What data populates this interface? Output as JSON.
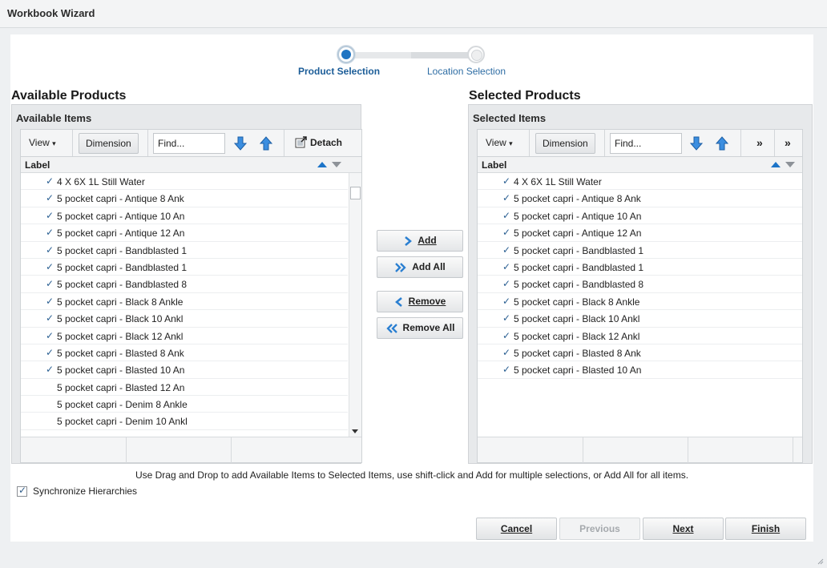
{
  "window": {
    "title": "Workbook Wizard"
  },
  "train": {
    "steps": [
      {
        "label": "Product Selection",
        "state": "active"
      },
      {
        "label": "Location Selection",
        "state": "inactive"
      }
    ]
  },
  "available": {
    "section_title": "Available Products",
    "panel_title": "Available Items",
    "toolbar": {
      "view": "View",
      "dimension": "Dimension",
      "find_placeholder": "Find...",
      "detach": "Detach"
    },
    "column_label": "Label",
    "rows": [
      {
        "checked": true,
        "text": "4 X 6X 1L Still Water"
      },
      {
        "checked": true,
        "text": "5 pocket capri - Antique 8 Ank"
      },
      {
        "checked": true,
        "text": "5 pocket capri - Antique 10 An"
      },
      {
        "checked": true,
        "text": "5 pocket capri - Antique 12 An"
      },
      {
        "checked": true,
        "text": "5 pocket capri - Bandblasted 1"
      },
      {
        "checked": true,
        "text": "5 pocket capri - Bandblasted 1"
      },
      {
        "checked": true,
        "text": "5 pocket capri - Bandblasted 8"
      },
      {
        "checked": true,
        "text": "5 pocket capri - Black 8 Ankle"
      },
      {
        "checked": true,
        "text": "5 pocket capri - Black 10 Ankl"
      },
      {
        "checked": true,
        "text": "5 pocket capri - Black 12 Ankl"
      },
      {
        "checked": true,
        "text": "5 pocket capri - Blasted 8 Ank"
      },
      {
        "checked": true,
        "text": "5 pocket capri - Blasted 10 An"
      },
      {
        "checked": false,
        "text": "5 pocket capri - Blasted 12 An"
      },
      {
        "checked": false,
        "text": "5 pocket capri - Denim 8 Ankle"
      },
      {
        "checked": false,
        "text": "5 pocket capri - Denim 10 Ankl"
      }
    ]
  },
  "selected": {
    "section_title": "Selected Products",
    "panel_title": "Selected Items",
    "toolbar": {
      "view": "View",
      "dimension": "Dimension",
      "find_placeholder": "Find...",
      "more1": "»",
      "more2": "»"
    },
    "column_label": "Label",
    "rows": [
      {
        "checked": true,
        "text": "4 X 6X 1L Still Water"
      },
      {
        "checked": true,
        "text": "5 pocket capri - Antique 8 Ank"
      },
      {
        "checked": true,
        "text": "5 pocket capri - Antique 10 An"
      },
      {
        "checked": true,
        "text": "5 pocket capri - Antique 12 An"
      },
      {
        "checked": true,
        "text": "5 pocket capri - Bandblasted 1"
      },
      {
        "checked": true,
        "text": "5 pocket capri - Bandblasted 1"
      },
      {
        "checked": true,
        "text": "5 pocket capri - Bandblasted 8"
      },
      {
        "checked": true,
        "text": "5 pocket capri - Black 8 Ankle"
      },
      {
        "checked": true,
        "text": "5 pocket capri - Black 10 Ankl"
      },
      {
        "checked": true,
        "text": "5 pocket capri - Black 12 Ankl"
      },
      {
        "checked": true,
        "text": "5 pocket capri - Blasted 8 Ank"
      },
      {
        "checked": true,
        "text": "5 pocket capri - Blasted 10 An"
      }
    ]
  },
  "shuttle": {
    "add": "Add",
    "add_all": "Add All",
    "remove": "Remove",
    "remove_all": "Remove All"
  },
  "hint": "Use Drag and Drop to add Available Items to Selected Items, use shift-click and Add for multiple selections, or Add All for all items.",
  "sync": {
    "label": "Synchronize Hierarchies",
    "checked": true
  },
  "footer": {
    "cancel": "Cancel",
    "previous": "Previous",
    "next": "Next",
    "finish": "Finish"
  },
  "colors": {
    "accent": "#1f74c2",
    "check": "#2a5f92",
    "panel_bg": "#e7e9eb"
  }
}
